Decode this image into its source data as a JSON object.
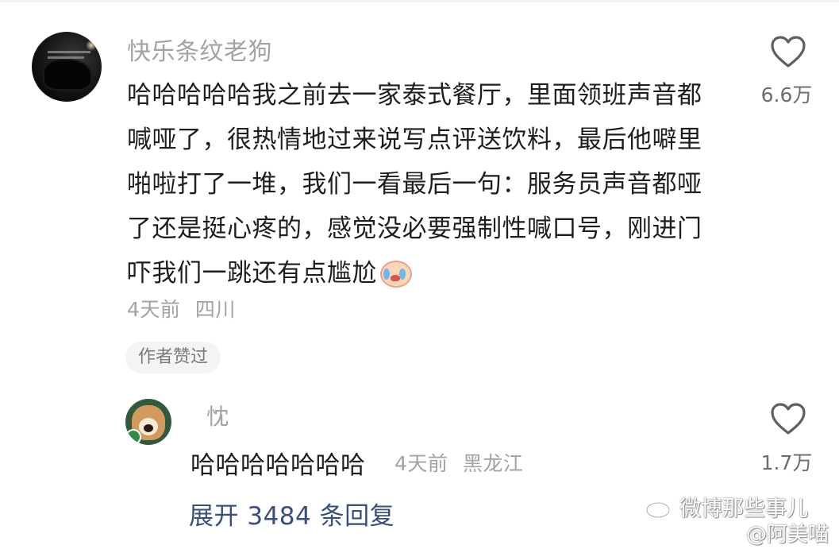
{
  "main_comment": {
    "username": "快乐条纹老狗",
    "text": "哈哈哈哈哈我之前去一家泰式餐厅，里面领班声音都喊哑了，很热情地过来说写点评送饮料，最后他噼里啪啦打了一堆，我们一看最后一句：服务员声音都哑了还是挺心疼的，感觉没必要强制性喊口号，刚进门吓我们一跳还有点尴尬",
    "emoji_icon": "crying-face-icon",
    "time": "4天前",
    "location": "四川",
    "author_liked_label": "作者赞过",
    "like_icon": "heart-outline-icon",
    "like_count": "6.6万"
  },
  "reply": {
    "username": "忱",
    "text": "哈哈哈哈哈哈哈",
    "time": "4天前",
    "location": "黑龙江",
    "like_icon": "heart-outline-icon",
    "like_count": "1.7万"
  },
  "expand_label": "展开 3484 条回复",
  "watermark": {
    "icon": "weibo-logo-icon",
    "text": "微博那些事儿",
    "handle": "@阿美喵"
  },
  "colors": {
    "username_gray": "#a3a3a3",
    "body_text": "#1e1e1e",
    "expand_link": "#3a4d7c",
    "tag_background": "#f4f4f4"
  }
}
